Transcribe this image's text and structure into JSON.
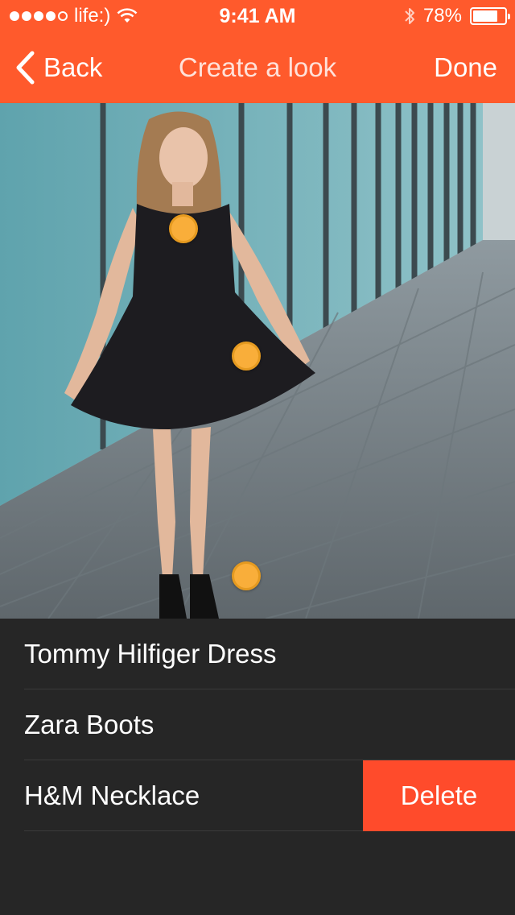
{
  "status_bar": {
    "carrier": "life:)",
    "time": "9:41 AM",
    "battery_text": "78%",
    "battery_level": 0.78
  },
  "nav": {
    "back_label": "Back",
    "title": "Create a look",
    "done_label": "Done"
  },
  "tags": [
    {
      "label": "Tommy Hilfiger Dress"
    },
    {
      "label": "Zara Boots"
    },
    {
      "label": "H&M Necklace",
      "action_label": "Delete"
    }
  ],
  "colors": {
    "accent": "#ff5a2c",
    "delete": "#ff4b2b",
    "tag_dot": "#f9ae3a",
    "list_background": "#262626"
  },
  "icons": [
    "signal-icon",
    "wifi-icon",
    "bluetooth-icon",
    "battery-icon",
    "back-chevron-icon"
  ]
}
